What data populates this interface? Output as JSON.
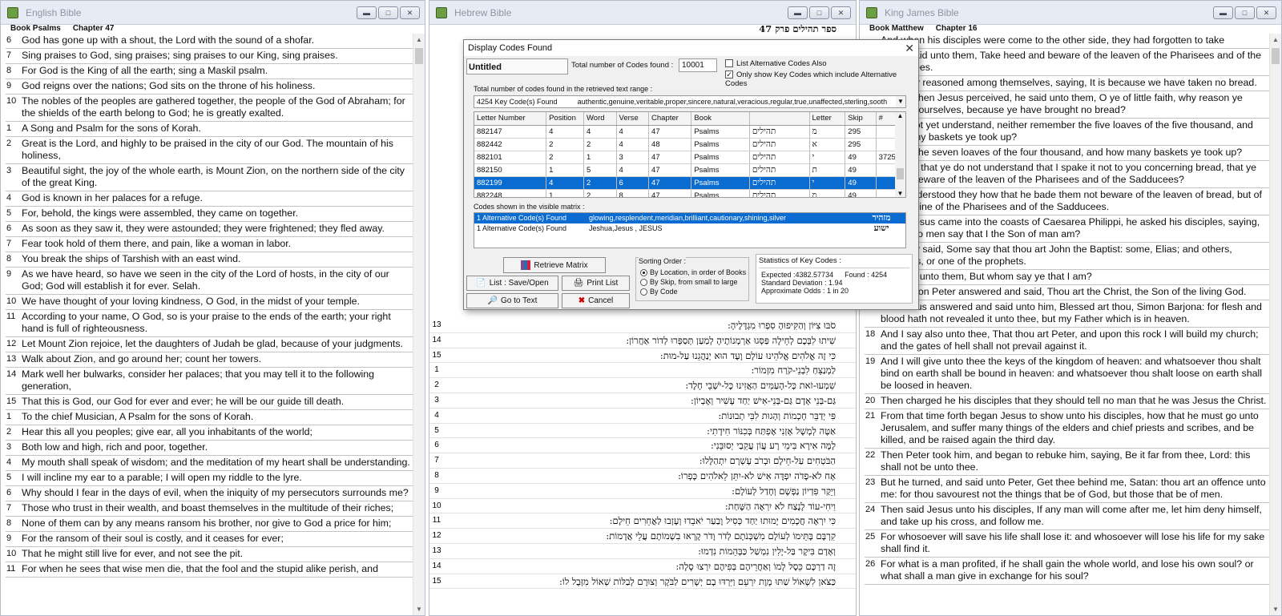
{
  "english": {
    "title": "English Bible",
    "crumb_book": "Book Psalms",
    "crumb_chapter": "Chapter 47",
    "verses": [
      {
        "n": "6",
        "t": "God has gone up with a shout, the Lord with the sound of a shofar."
      },
      {
        "n": "7",
        "t": "Sing praises to God, sing praises; sing praises to our King, sing praises."
      },
      {
        "n": "8",
        "t": "For God is the King of all the earth; sing a Maskil psalm."
      },
      {
        "n": "9",
        "t": "God reigns over the nations; God sits on the throne of his holiness."
      },
      {
        "n": "10",
        "t": "The nobles of the peoples are gathered together, the people of the God of Abraham; for the shields of the earth belong to God; he is greatly exalted."
      },
      {
        "n": "1",
        "t": "A Song and Psalm for the sons of Korah."
      },
      {
        "n": "2",
        "t": "Great is the Lord, and highly to be praised in the city of our God. The mountain of his holiness,"
      },
      {
        "n": "3",
        "t": "Beautiful sight, the joy of the whole earth, is Mount Zion, on the northern side of the city of the great King."
      },
      {
        "n": "4",
        "t": "God is known in her palaces for a refuge."
      },
      {
        "n": "5",
        "t": "For, behold, the kings were assembled, they came on together."
      },
      {
        "n": "6",
        "t": "As soon as they saw it, they were astounded; they were frightened; they fled away."
      },
      {
        "n": "7",
        "t": "Fear took hold of them there, and pain, like a woman in labor."
      },
      {
        "n": "8",
        "t": "You break the ships of Tarshish with an east wind."
      },
      {
        "n": "9",
        "t": "As we have heard, so have we seen in the city of the Lord of hosts, in the city of our God; God will establish it for ever. Selah."
      },
      {
        "n": "10",
        "t": "We have thought of your loving kindness, O God, in the midst of your temple."
      },
      {
        "n": "11",
        "t": "According to your name, O God, so is your praise to the ends of the earth; your right hand is full of righteousness."
      },
      {
        "n": "12",
        "t": "Let Mount Zion rejoice, let the daughters of Judah be glad, because of your judgments."
      },
      {
        "n": "13",
        "t": "Walk about Zion, and go around her; count her towers."
      },
      {
        "n": "14",
        "t": "Mark well her bulwarks, consider her palaces; that you may tell it to the following generation,"
      },
      {
        "n": "15",
        "t": "That this is God, our God for ever and ever; he will be our guide till death."
      },
      {
        "n": "1",
        "t": "To the chief Musician, A Psalm for the sons of Korah."
      },
      {
        "n": "2",
        "t": "Hear this all you peoples; give ear, all you inhabitants of the world;"
      },
      {
        "n": "3",
        "t": "Both low and high, rich and poor, together."
      },
      {
        "n": "4",
        "t": "My mouth shall speak of wisdom; and the meditation of my heart shall be understanding."
      },
      {
        "n": "5",
        "t": "I will incline my ear to a parable; I will open my riddle to the lyre."
      },
      {
        "n": "6",
        "t": "Why should I fear in the days of evil, when the iniquity of my persecutors surrounds me?"
      },
      {
        "n": "7",
        "t": "Those who trust in their wealth, and boast themselves in the multitude of their riches;"
      },
      {
        "n": "8",
        "t": "None of them can by any means ransom his brother, nor give to God a price for him;"
      },
      {
        "n": "9",
        "t": "For the ransom of their soul is costly, and it ceases for ever;"
      },
      {
        "n": "10",
        "t": "That he might still live for ever, and not see the pit."
      },
      {
        "n": "11",
        "t": "For when he sees that wise men die, that the fool and the stupid alike perish, and"
      }
    ]
  },
  "hebrew": {
    "title": "Hebrew Bible",
    "crumb": "ספר תהילים   פרק 47",
    "verses": [
      {
        "n": "13",
        "t": "סֹבּוּ צִיּוֹן וְהַקִּיפוּהָ סִפְרוּ מִגְדָּלֶיהָ:"
      },
      {
        "n": "14",
        "t": "שִׁיתוּ לִבְּכֶם לְחֵילָה פַּסְּגוּ אַרְמְנוֹתֶיהָ לְמַעַן תְּסַפְּרוּ לְדוֹר אַחֲרוֹן:"
      },
      {
        "n": "15",
        "t": "כִּי זֶה אֱלֹהִים אֱלֹהֵינוּ עוֹלָם וָעֶד הוּא יְנַהֲגֵנוּ עַל-מוּת:"
      },
      {
        "n": "1",
        "t": "לַמְנַצֵּחַ לִבְנֵי-קֹרַח מִזְמוֹר:"
      },
      {
        "n": "2",
        "t": "שִׁמְעוּ-זֹאת כָּל-הָעַמִּים הַאֲזִינוּ כָּל-יֹשְׁבֵי חָלֶד:"
      },
      {
        "n": "3",
        "t": "גַּם-בְּנֵי אָדָם גַּם-בְּנֵי-אִישׁ יַחַד עָשִׁיר וְאֶבְיוֹן:"
      },
      {
        "n": "4",
        "t": "פִּי יְדַבֵּר חָכְמוֹת וְהָגוּת לִבִּי תְבוּנוֹת:"
      },
      {
        "n": "5",
        "t": "אַטֶּה לְמָשָׁל אָזְנִי אֶפְתַּח בְּכִנּוֹר חִידָתִי:"
      },
      {
        "n": "6",
        "t": "לָמָּה אִירָא בִּימֵי רָע עֲוֹן עֲקֵבַי יְסוּבֵּנִי:"
      },
      {
        "n": "7",
        "t": "הַבֹּטְחִים עַל-חֵילָם וּבְרֹב עָשְׁרָם יִתְהַלָּלוּ:"
      },
      {
        "n": "8",
        "t": "אָח לֹא-פָדֹה יִפְדֶּה אִישׁ לֹא-יִתֵּן לֵאלֹהִים כָּפְרוֹ:"
      },
      {
        "n": "9",
        "t": "וְיֵקַר פִּדְיוֹן נַפְשָׁם וְחָדַל לְעוֹלָם:"
      },
      {
        "n": "10",
        "t": "וִיחִי-עוֹד לָנֶצַח לֹא יִרְאֶה הַשָּׁחַת:"
      },
      {
        "n": "11",
        "t": "כִּי יִרְאֶה חֲכָמִים יָמוּתוּ יַחַד כְּסִיל וָבַעַר יֹאבֵדוּ וְעָזְבוּ לַאֲחֵרִים חֵילָם:"
      },
      {
        "n": "12",
        "t": "קִרְבָּם בָּתֵּימוֹ לְעוֹלָם מִשְׁכְּנֹתָם לְדֹר וָדֹר קָרְאוּ בִשְׁמוֹתָם עֲלֵי אֲדָמוֹת:"
      },
      {
        "n": "13",
        "t": "וְאָדָם בִּיקָר בַּל-יָלִין נִמְשַׁל כַּבְּהֵמוֹת נִדְמוּ:"
      },
      {
        "n": "14",
        "t": "זֶה דַרְכָּם כֵּסֶל לָמוֹ וְאַחֲרֵיהֶם בְּפִיהֶם יִרְצוּ סֶלָה:"
      },
      {
        "n": "15",
        "t": "כַּצֹּאן לִשְׁאוֹל שַׁתּוּ מָוֶת יִרְעֵם וַיִּרְדּוּ בָם יְשָׁרִים לַבֹּקֶר וְצוּרָם לְבַלּוֹת שְׁאוֹל מִזְּבֻל לוֹ:"
      }
    ]
  },
  "kjv": {
    "title": "King James Bible",
    "crumb_book": "Book Matthew",
    "crumb_chapter": "Chapter 16",
    "verses": [
      {
        "n": "",
        "t": "And when his disciples were come to the other side, they had forgotten to take"
      },
      {
        "n": "",
        "t": "Jesus said unto them, Take heed and beware of the leaven of the Pharisees and of the Sadducees."
      },
      {
        "n": "",
        "t": "And they reasoned among themselves, saying, It is because we have taken no bread."
      },
      {
        "n": "",
        "t": "Which when Jesus perceived, he said unto them, O ye of little faith, why reason ye among yourselves, because ye have brought no bread?"
      },
      {
        "n": "",
        "t": "Do ye not yet understand, neither remember the five loaves of the five thousand, and how many baskets ye took up?"
      },
      {
        "n": "",
        "t": "Neither the seven loaves of the four thousand, and how many baskets ye took up?"
      },
      {
        "n": "",
        "t": "How is it that ye do not understand that I spake it not to you concerning bread, that ye should beware of the leaven of the Pharisees and of the Sadducees?"
      },
      {
        "n": "",
        "t": "Then understood they how that he bade them not beware of the leaven of bread, but of the doctrine of the Pharisees and of the Sadducees."
      },
      {
        "n": "",
        "t": "When Jesus came into the coasts of Caesarea Philippi, he asked his disciples, saying, Whom do men say that I the Son of man am?"
      },
      {
        "n": "",
        "t": "And they said, Some say that thou art John the Baptist: some, Elias; and others, Jeremias, or one of the prophets."
      },
      {
        "n": "",
        "t": "He saith unto them, But whom say ye that I am?"
      },
      {
        "n": "16",
        "t": "And Simon Peter answered and said, Thou art the Christ, the Son of the living God."
      },
      {
        "n": "17",
        "t": "And Jesus answered and said unto him, Blessed art thou, Simon Barjona: for flesh and blood hath not revealed it unto thee, but my Father which is in heaven."
      },
      {
        "n": "18",
        "t": "And I say also unto thee, That thou art Peter, and upon this rock I will build my church; and the gates of hell shall not prevail against it."
      },
      {
        "n": "19",
        "t": "And I will give unto thee the keys of the kingdom of heaven: and whatsoever thou shalt bind on earth shall be bound in heaven: and whatsoever thou shalt loose on earth shall be loosed in heaven."
      },
      {
        "n": "20",
        "t": "Then charged he his disciples that they should tell no man that he was Jesus the Christ."
      },
      {
        "n": "21",
        "t": "From that time forth began Jesus to show unto his disciples, how that he must go unto Jerusalem, and suffer many things of the elders and chief priests and scribes, and be killed, and be raised again the third day."
      },
      {
        "n": "22",
        "t": "Then Peter took him, and began to rebuke him, saying, Be it far from thee, Lord: this shall not be unto thee."
      },
      {
        "n": "23",
        "t": "But he turned, and said unto Peter, Get thee behind me, Satan: thou art an offence unto me: for thou savourest not the things that be of God, but those that be of men."
      },
      {
        "n": "24",
        "t": "Then said Jesus unto his disciples, If any man will come after me, let him deny himself, and take up his cross, and follow me."
      },
      {
        "n": "25",
        "t": "For whosoever will save his life shall lose it: and whosoever will lose his life for my sake shall find it."
      },
      {
        "n": "26",
        "t": "For what is a man profited, if he shall gain the whole world, and lose his own soul? or what shall a man give in exchange for his soul?"
      }
    ]
  },
  "dialog": {
    "title": "Display Codes Found",
    "name_field": "Untitled",
    "total_label": "Total number of Codes found :",
    "total_value": "10001",
    "chk_alt_label": "List Alternative Codes Also",
    "chk_key_label": "Only show Key Codes which include Alternative Codes",
    "range_label": "Total number of codes found in the retrieved text range :",
    "range_combo": "4254 Key Code(s) Found          authentic,genuine,veritable,proper,sincere,natural,veracious,regular,true,unaffected,sterling,sooth",
    "columns": [
      "Letter Number",
      "Position",
      "Word",
      "Verse",
      "Chapter",
      "Book",
      "",
      "Letter",
      "Skip",
      "#"
    ],
    "rows": [
      [
        "882147",
        "4",
        "4",
        "4",
        "47",
        "Psalms",
        "תהילים",
        "מ",
        "295",
        ""
      ],
      [
        "882442",
        "2",
        "2",
        "4",
        "48",
        "Psalms",
        "תהילים",
        "א",
        "295",
        ""
      ],
      [
        "882101",
        "2",
        "1",
        "3",
        "47",
        "Psalms",
        "תהילים",
        "י",
        "49",
        "3725"
      ],
      [
        "882150",
        "1",
        "5",
        "4",
        "47",
        "Psalms",
        "תהילים",
        "ת",
        "49",
        ""
      ],
      [
        "882199",
        "4",
        "2",
        "6",
        "47",
        "Psalms",
        "תהילים",
        "י",
        "49",
        ""
      ],
      [
        "882248",
        "1",
        "2",
        "8",
        "47",
        "Psalms",
        "תהילים",
        "מ",
        "49",
        ""
      ]
    ],
    "visible_label": "Codes shown in the visible matrix :",
    "visible": [
      {
        "count": "1 Alternative Code(s) Found",
        "words": "glowing,resplendent,meridian,brilliant,cautionary,shining,silver",
        "heb": "מזהיר"
      },
      {
        "count": "1 Alternative Code(s) Found",
        "words": "Jeshua,Jesus , JESUS",
        "heb": "ישוע"
      }
    ],
    "btn_retrieve": "Retrieve Matrix",
    "btn_list": "List : Save/Open",
    "btn_print": "Print List",
    "btn_goto": "Go to Text",
    "btn_cancel": "Cancel",
    "sort_label": "Sorting Order :",
    "sort_opts": [
      "By Location, in order of Books",
      "By Skip, from small to large",
      "By Code"
    ],
    "stats_label": "Statistics of Key Codes :",
    "stats_expected": "Expected :4382.57734",
    "stats_found": "Found :  4254",
    "stats_std": "Standard Deviation :      1.94",
    "stats_odds": "Approximate Odds :  1 in 20"
  }
}
